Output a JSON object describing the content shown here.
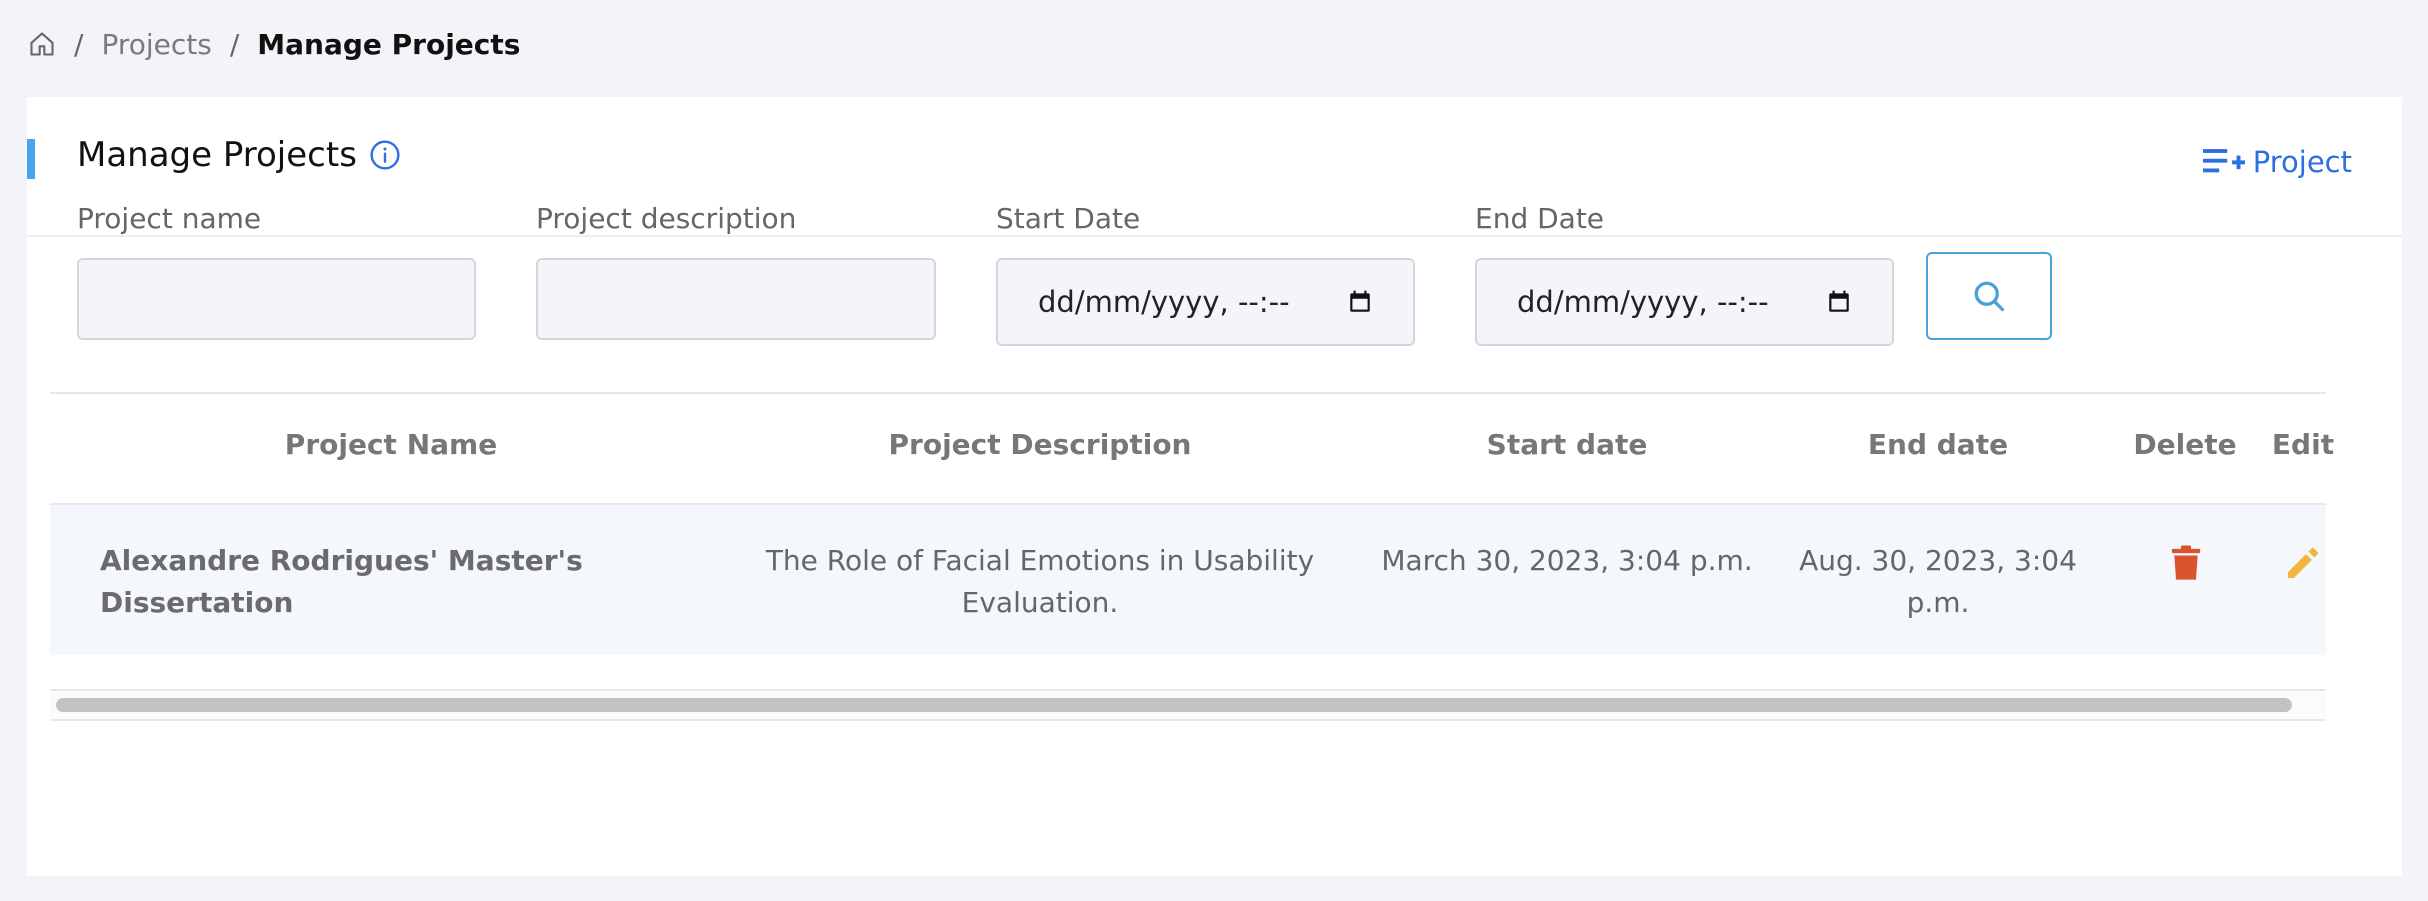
{
  "breadcrumb": {
    "home_icon": "home-icon",
    "separator": "/",
    "items": [
      "Projects",
      "Manage Projects"
    ]
  },
  "header": {
    "title": "Manage Projects",
    "info_icon": "info-icon",
    "add_project_label": "Project",
    "add_project_icon": "playlist-add-icon"
  },
  "filters": {
    "project_name_label": "Project name",
    "project_name_value": "",
    "project_description_label": "Project description",
    "project_description_value": "",
    "start_date_label": "Start Date",
    "start_date_placeholder": "dd/mm/yyyy, --:--",
    "end_date_label": "End Date",
    "end_date_placeholder": "dd/mm/yyyy, --:--",
    "search_icon": "search-icon"
  },
  "table": {
    "columns": [
      "Project Name",
      "Project Description",
      "Start date",
      "End date",
      "Delete",
      "Edit"
    ],
    "rows": [
      {
        "name": "Alexandre Rodrigues' Master's Dissertation",
        "description_line1": "The Role of Facial Emotions in Usability",
        "description_line2": "Evaluation.",
        "start": "March 30, 2023, 3:04 p.m.",
        "end": "Aug. 30, 2023, 3:04 p.m."
      }
    ]
  },
  "colors": {
    "accent": "#4aa3ee",
    "link": "#2c6fe0",
    "delete": "#d9532c",
    "edit": "#f0b53a"
  }
}
